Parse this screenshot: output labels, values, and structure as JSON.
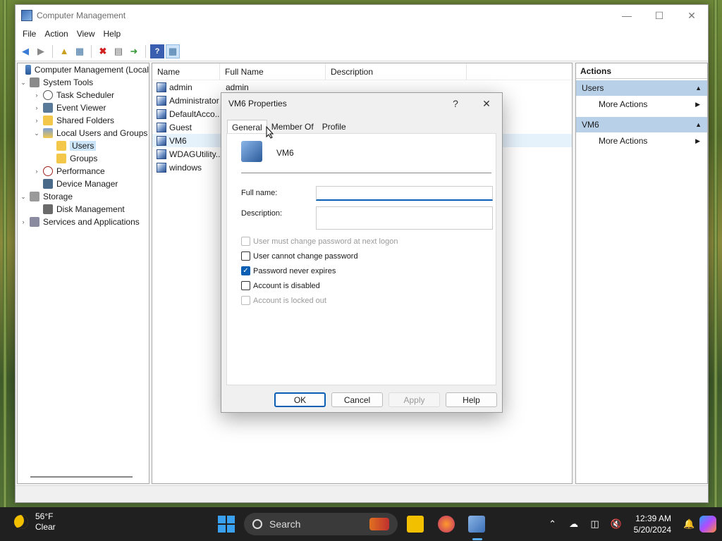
{
  "window": {
    "title": "Computer Management",
    "menu": [
      "File",
      "Action",
      "View",
      "Help"
    ]
  },
  "tree": {
    "items": [
      {
        "label": "Computer Management (Local",
        "level": 0,
        "chev": "",
        "icon": "computer-icon",
        "selected": false
      },
      {
        "label": "System Tools",
        "level": 0,
        "chev": "⌄",
        "icon": "tools-icon",
        "selected": false
      },
      {
        "label": "Task Scheduler",
        "level": 1,
        "chev": "›",
        "icon": "clock-icon",
        "selected": false
      },
      {
        "label": "Event Viewer",
        "level": 1,
        "chev": "›",
        "icon": "event-viewer-icon",
        "selected": false
      },
      {
        "label": "Shared Folders",
        "level": 1,
        "chev": "›",
        "icon": "shared-folder-icon",
        "selected": false
      },
      {
        "label": "Local Users and Groups",
        "level": 1,
        "chev": "⌄",
        "icon": "users-groups-icon",
        "selected": false
      },
      {
        "label": "Users",
        "level": 2,
        "chev": "",
        "icon": "folder-icon",
        "selected": true
      },
      {
        "label": "Groups",
        "level": 2,
        "chev": "",
        "icon": "folder-icon",
        "selected": false
      },
      {
        "label": "Performance",
        "level": 1,
        "chev": "›",
        "icon": "performance-icon",
        "selected": false
      },
      {
        "label": "Device Manager",
        "level": 1,
        "chev": "",
        "icon": "device-manager-icon",
        "selected": false
      },
      {
        "label": "Storage",
        "level": 0,
        "chev": "⌄",
        "icon": "storage-icon",
        "selected": false
      },
      {
        "label": "Disk Management",
        "level": 1,
        "chev": "",
        "icon": "disk-icon",
        "selected": false
      },
      {
        "label": "Services and Applications",
        "level": 0,
        "chev": "›",
        "icon": "services-icon",
        "selected": false
      }
    ]
  },
  "list": {
    "columns": [
      "Name",
      "Full Name",
      "Description"
    ],
    "rows": [
      {
        "name": "admin",
        "full_name": "admin"
      },
      {
        "name": "Administrator",
        "full_name": ""
      },
      {
        "name": "DefaultAcco...",
        "full_name": ""
      },
      {
        "name": "Guest",
        "full_name": ""
      },
      {
        "name": "VM6",
        "full_name": ""
      },
      {
        "name": "WDAGUtility...",
        "full_name": ""
      },
      {
        "name": "windows",
        "full_name": ""
      }
    ]
  },
  "actions": {
    "header": "Actions",
    "sections": [
      {
        "title": "Users",
        "item": "More Actions"
      },
      {
        "title": "VM6",
        "item": "More Actions"
      }
    ]
  },
  "dialog": {
    "title": "VM6 Properties",
    "help_glyph": "?",
    "close_glyph": "✕",
    "tabs": [
      "General",
      "Member Of",
      "Profile"
    ],
    "username": "VM6",
    "full_name_label": "Full name:",
    "full_name_value": "",
    "description_label": "Description:",
    "description_value": "",
    "checkboxes": [
      {
        "label": "User must change password at next logon",
        "checked": false,
        "disabled": true
      },
      {
        "label": "User cannot change password",
        "checked": false,
        "disabled": false
      },
      {
        "label": "Password never expires",
        "checked": true,
        "disabled": false
      },
      {
        "label": "Account is disabled",
        "checked": false,
        "disabled": false
      },
      {
        "label": "Account is locked out",
        "checked": false,
        "disabled": true
      }
    ],
    "buttons": {
      "ok": "OK",
      "cancel": "Cancel",
      "apply": "Apply",
      "help": "Help"
    }
  },
  "taskbar": {
    "temperature": "56°F",
    "weather": "Clear",
    "search": "Search",
    "time": "12:39 AM",
    "date": "5/20/2024"
  },
  "colors": {
    "accent": "#0a5fb4",
    "selection": "#cce4f7",
    "action_header": "#b8d0e8"
  }
}
